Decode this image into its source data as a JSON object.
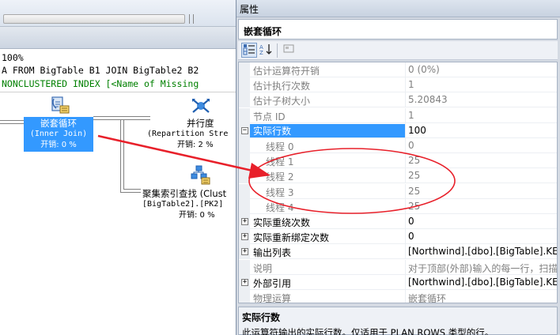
{
  "plan": {
    "zoom": "100%",
    "query_text": "A FROM BigTable B1 JOIN BigTable2 B2",
    "missing_index_text": "NONCLUSTERED INDEX [<Name of Missing",
    "nodes": {
      "nested_loop": {
        "title": "嵌套循环",
        "subtitle": "(Inner Join)",
        "cost": "开销: 0 %"
      },
      "parallelism": {
        "title": "并行度",
        "subtitle": "(Repartition Stre",
        "cost": "开销: 2 %"
      },
      "clustered_seek": {
        "title": "聚集索引查找 (Clust",
        "subtitle": "[BigTable2].[PK2]",
        "cost": "开销: 0 %"
      }
    }
  },
  "properties": {
    "window_title": "属性",
    "object_name": "嵌套循环",
    "toolbar": {
      "categorized": "categorized-icon",
      "alphabetical": "alphabetical-icon",
      "pages": "property-pages-icon"
    },
    "rows": [
      {
        "name": "估计运算符开销",
        "value": "0 (0%)",
        "readonly": true,
        "level": 0,
        "expander": ""
      },
      {
        "name": "估计执行次数",
        "value": "1",
        "readonly": true,
        "level": 0,
        "expander": ""
      },
      {
        "name": "估计子树大小",
        "value": "5.20843",
        "readonly": true,
        "level": 0,
        "expander": ""
      },
      {
        "name": "节点 ID",
        "value": "1",
        "readonly": true,
        "level": 0,
        "expander": ""
      },
      {
        "name": "实际行数",
        "value": "100",
        "readonly": false,
        "level": 0,
        "expander": "−",
        "selected": true
      },
      {
        "name": "线程 0",
        "value": "0",
        "readonly": true,
        "level": 1,
        "expander": ""
      },
      {
        "name": "线程 1",
        "value": "25",
        "readonly": true,
        "level": 1,
        "expander": ""
      },
      {
        "name": "线程 2",
        "value": "25",
        "readonly": true,
        "level": 1,
        "expander": ""
      },
      {
        "name": "线程 3",
        "value": "25",
        "readonly": true,
        "level": 1,
        "expander": ""
      },
      {
        "name": "线程 4",
        "value": "25",
        "readonly": true,
        "level": 1,
        "expander": ""
      },
      {
        "name": "实际重绕次数",
        "value": "0",
        "readonly": false,
        "level": 0,
        "expander": "+"
      },
      {
        "name": "实际重新绑定次数",
        "value": "0",
        "readonly": false,
        "level": 0,
        "expander": "+"
      },
      {
        "name": "输出列表",
        "value": "[Northwind].[dbo].[BigTable].KEY,",
        "readonly": false,
        "level": 0,
        "expander": "+"
      },
      {
        "name": "说明",
        "value": "对于顶部(外部)输入的每一行，扫描底",
        "readonly": true,
        "level": 0,
        "expander": ""
      },
      {
        "name": "外部引用",
        "value": "[Northwind].[dbo].[BigTable].KEY",
        "readonly": false,
        "level": 0,
        "expander": "+"
      },
      {
        "name": "物理运算",
        "value": "嵌套循环",
        "readonly": true,
        "level": 0,
        "expander": ""
      }
    ],
    "description": {
      "title": "实际行数",
      "text": "此运算符输出的实际行数。仅适用于 PLAN ROWS 类型的行。"
    }
  },
  "colors": {
    "selection": "#3399ff",
    "annotation": "#e8202a",
    "missing_index": "#008000"
  }
}
